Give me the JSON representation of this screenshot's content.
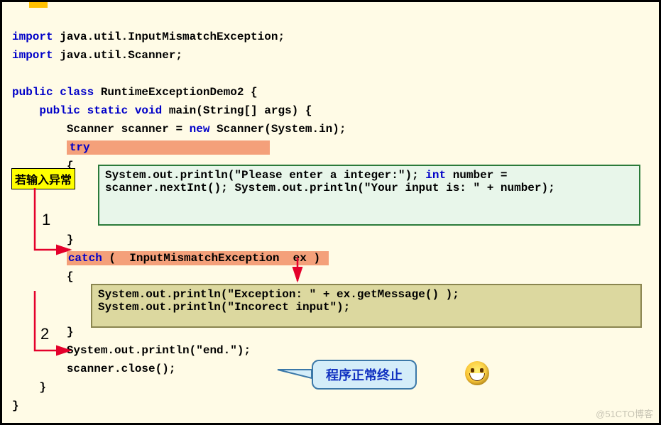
{
  "code": {
    "import1_kw": "import",
    "import1_rest": " java.util.InputMismatchException;",
    "import2_kw": "import",
    "import2_rest": " java.util.Scanner;",
    "classdecl_kw": "public class",
    "classdecl_name": " RuntimeExceptionDemo2 {",
    "maindecl_kw": "    public static void",
    "maindecl_rest": " main(String[] args) {",
    "scanner_pre": "        Scanner scanner = ",
    "scanner_kw": "new",
    "scanner_post": " Scanner(System.in);",
    "try_indent": "        ",
    "try_kw": "try                          ",
    "brace_open1": "        {",
    "green_l1": "System.out.println(\"Please enter a integer:\");",
    "green_l2_pre": "int",
    "green_l2_post": " number = scanner.nextInt();",
    "green_l3": "System.out.println(\"Your input is: \" + number);",
    "brace_close1": "        }",
    "catch_indent": "        ",
    "catch_kw": "catch",
    "catch_rest": " (  InputMismatchException  ex ) ",
    "brace_open2": "        {",
    "olive_l1": "System.out.println(\"Exception: \" + ex.getMessage() );",
    "olive_l2": "System.out.println(\"Incorect input\");",
    "brace_close2": "        }",
    "end_line": "        System.out.println(\"end.\");",
    "close_line": "        scanner.close();",
    "mainclose": "    }",
    "classclose": "}"
  },
  "labels": {
    "input_exception": "若输入异常",
    "num1": "1",
    "num2": "2",
    "callout": "程序正常终止",
    "watermark": "@51CTO博客"
  }
}
